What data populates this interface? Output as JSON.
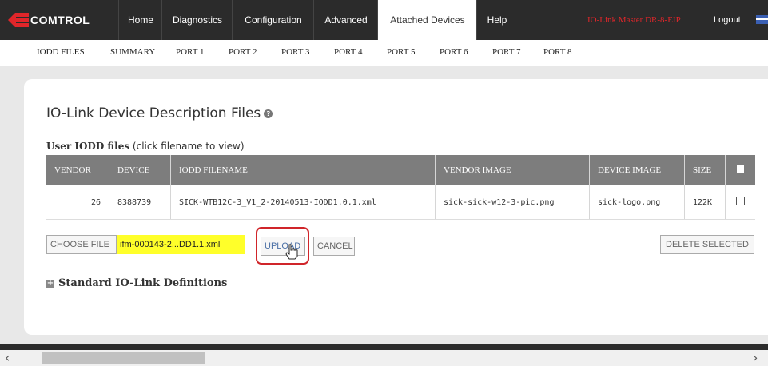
{
  "brand": {
    "logo_text": "COMTROL"
  },
  "nav": {
    "items": [
      {
        "label": "Home"
      },
      {
        "label": "Diagnostics"
      },
      {
        "label": "Configuration"
      },
      {
        "label": "Advanced"
      },
      {
        "label": "Attached Devices"
      },
      {
        "label": "Help"
      }
    ],
    "active": "Attached Devices",
    "device_name": "IO-Link Master DR-8-EIP",
    "logout_label": "Logout"
  },
  "subnav": {
    "items": [
      {
        "label": "IODD FILES"
      },
      {
        "label": "SUMMARY"
      },
      {
        "label": "PORT 1"
      },
      {
        "label": "PORT 2"
      },
      {
        "label": "PORT 3"
      },
      {
        "label": "PORT 4"
      },
      {
        "label": "PORT 5"
      },
      {
        "label": "PORT 6"
      },
      {
        "label": "PORT 7"
      },
      {
        "label": "PORT 8"
      }
    ]
  },
  "main": {
    "title": "IO-Link Device Description Files",
    "help_icon": "?",
    "caption_bold": "User IODD files",
    "caption_rest": " (click filename to view)",
    "table": {
      "headers": [
        "VENDOR",
        "DEVICE",
        "IODD FILENAME",
        "VENDOR IMAGE",
        "DEVICE IMAGE",
        "SIZE"
      ],
      "rows": [
        {
          "vendor": "26",
          "device": "8388739",
          "filename": "SICK-WTB12C-3_V1_2-20140513-IODD1.0.1.xml",
          "vendor_image": "sick-sick-w12-3-pic.png",
          "device_image": "sick-logo.png",
          "size": "122K"
        }
      ]
    },
    "buttons": {
      "choose_file": "CHOOSE FILE",
      "selected_file": "ifm-000143-2...DD1.1.xml",
      "upload": "UPLOAD",
      "cancel": "CANCEL",
      "delete_selected": "DELETE SELECTED"
    },
    "standard_defs": "Standard IO-Link Definitions"
  },
  "colors": {
    "accent_red": "#e0262a",
    "nav_bg": "#2b2b2b",
    "file_highlight": "#ffff2a"
  }
}
